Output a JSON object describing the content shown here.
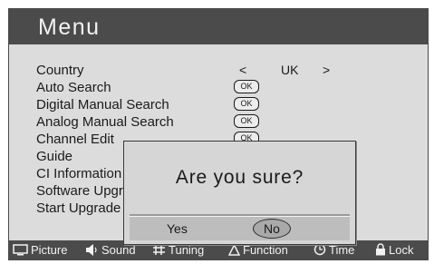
{
  "menu": {
    "title": "Menu",
    "items": [
      {
        "label": "Country"
      },
      {
        "label": "Auto Search",
        "action": "OK"
      },
      {
        "label": "Digital Manual Search",
        "action": "OK"
      },
      {
        "label": "Analog Manual Search",
        "action": "OK"
      },
      {
        "label": "Channel Edit",
        "action": "OK"
      },
      {
        "label": "Guide"
      },
      {
        "label": "CI Information"
      },
      {
        "label": "Software Upgrade"
      },
      {
        "label": "Start Upgrade"
      }
    ],
    "country": {
      "prev": "<",
      "value": "UK",
      "next": ">"
    }
  },
  "dialog": {
    "message": "Are you sure?",
    "yes_label": "Yes",
    "no_label": "No",
    "selected": "No"
  },
  "statusbar": {
    "items": [
      {
        "label": "Picture",
        "icon": "picture-icon"
      },
      {
        "label": "Sound",
        "icon": "speaker-icon"
      },
      {
        "label": "Tuning",
        "icon": "tuning-icon"
      },
      {
        "label": "Function",
        "icon": "function-icon"
      },
      {
        "label": "Time",
        "icon": "clock-icon"
      },
      {
        "label": "Lock",
        "icon": "lock-icon"
      }
    ]
  },
  "colors": {
    "header_bg": "#4b4b4b",
    "panel_bg": "#dcdcdc",
    "dialog_bg": "#d6d6d6",
    "button_bar_bg": "#bdbdbd"
  }
}
